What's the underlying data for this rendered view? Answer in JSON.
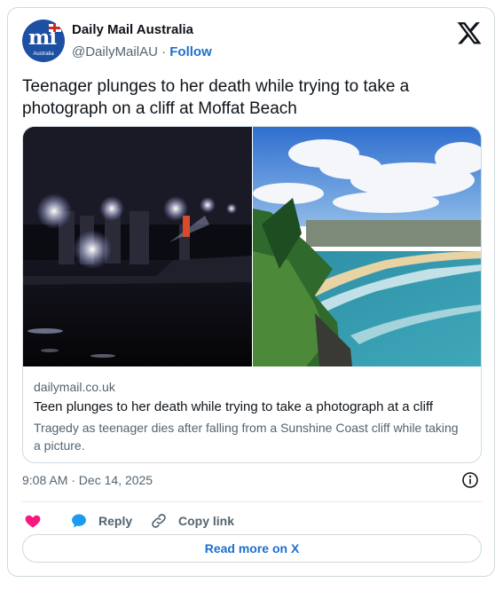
{
  "account": {
    "name": "Daily Mail Australia",
    "handle": "@DailyMailAU",
    "separator": "·",
    "follow_label": "Follow",
    "avatar_logo_text": "mi",
    "avatar_subtext": "Australia"
  },
  "tweet": {
    "text": "Teenager plunges to her death while trying to take a photograph on a cliff at Moffat Beach",
    "timestamp": "9:08 AM · Dec 14, 2025"
  },
  "link_card": {
    "domain": "dailymail.co.uk",
    "title": "Teen plunges to her death while trying to take a photograph at a cliff",
    "description": "Tragedy as teenager dies after falling from a Sunshine Coast cliff while taking a picture.",
    "left_image": "night-scene-with-torch-lights",
    "right_image": "moffat-beach-coastline"
  },
  "actions": {
    "like_icon": "heart-icon",
    "reply_label": "Reply",
    "reply_icon": "speech-bubble-icon",
    "copy_label": "Copy link",
    "copy_icon": "link-icon",
    "read_more_label": "Read more on X"
  },
  "colors": {
    "accent": "#1d6fd0",
    "like": "#f91880",
    "reply": "#1d9bf0",
    "text": "#0f1419",
    "muted": "#536471",
    "border": "#cfd9de"
  }
}
